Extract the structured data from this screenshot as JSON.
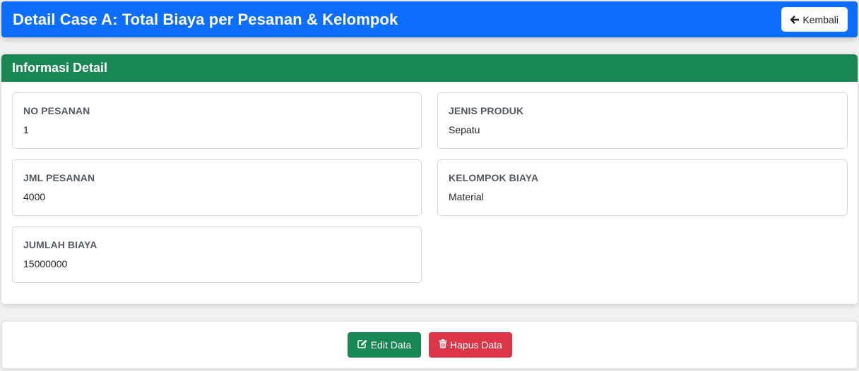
{
  "header": {
    "title": "Detail Case A: Total Biaya per Pesanan & Kelompok",
    "back_label": "Kembali",
    "color": "#0d6efd"
  },
  "card": {
    "title": "Informasi Detail",
    "header_color": "#198754",
    "fields": [
      {
        "label": "NO PESANAN",
        "value": "1"
      },
      {
        "label": "JENIS PRODUK",
        "value": "Sepatu"
      },
      {
        "label": "JML PESANAN",
        "value": "4000"
      },
      {
        "label": "KELOMPOK BIAYA",
        "value": "Material"
      },
      {
        "label": "JUMLAH BIAYA",
        "value": "15000000"
      }
    ]
  },
  "actions": {
    "edit_label": "Edit Data",
    "edit_color": "#198754",
    "delete_label": "Hapus Data",
    "delete_color": "#dc3545"
  },
  "icons": {
    "back": "arrow-left-icon",
    "edit": "edit-icon",
    "delete": "trash-icon"
  }
}
